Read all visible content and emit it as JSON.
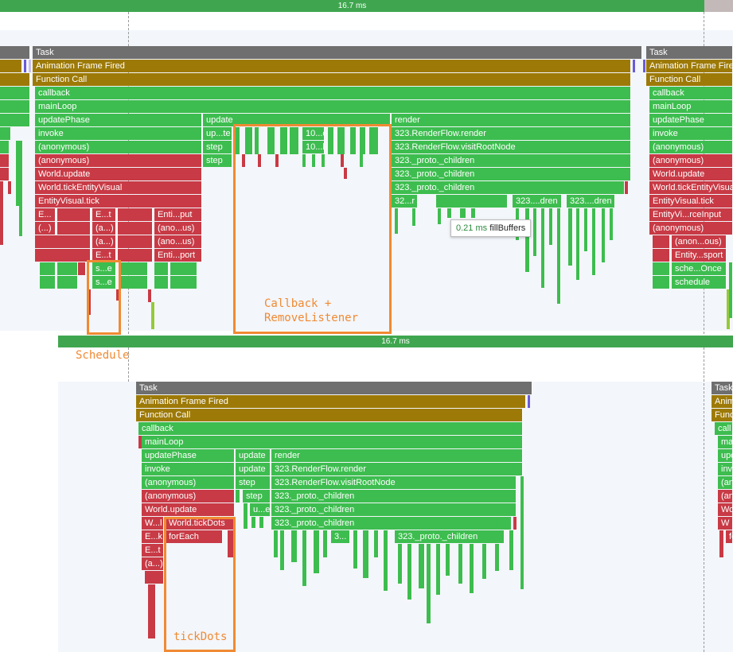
{
  "top_panel": {
    "frame_duration": "16.7 ms",
    "main": [
      {
        "row": 0,
        "label": "Task"
      },
      {
        "row": 1,
        "label": "Animation Frame Fired"
      },
      {
        "row": 2,
        "label": "Function Call"
      },
      {
        "row": 3,
        "label": "callback"
      },
      {
        "row": 4,
        "label": "mainLoop"
      },
      {
        "row": 5,
        "label": "updatePhase"
      },
      {
        "row": 6,
        "label": "invoke"
      },
      {
        "row": 7,
        "label": "(anonymous)"
      },
      {
        "row": 8,
        "label": "(anonymous)"
      },
      {
        "row": 9,
        "label": "World.update"
      },
      {
        "row": 10,
        "label": "World.tickEntityVisual"
      },
      {
        "row": 11,
        "label": "EntityVisual.tick"
      }
    ],
    "mid": [
      {
        "label": "update"
      },
      {
        "label": "up...te"
      },
      {
        "label": "step"
      },
      {
        "label": "step"
      }
    ],
    "render": [
      {
        "label": "render"
      },
      {
        "label": "323.RenderFlow.render"
      },
      {
        "label": "323.RenderFlow.visitRootNode"
      },
      {
        "label": "323._proto._children"
      },
      {
        "label": "323._proto._children"
      },
      {
        "label": "323._proto._children"
      },
      {
        "label": "32...r"
      },
      {
        "label": "323....dren"
      },
      {
        "label": "323....dren"
      }
    ],
    "small": [
      {
        "label": "10...e"
      },
      {
        "label": "10...l"
      },
      {
        "label": "E..."
      },
      {
        "label": "(...)"
      },
      {
        "label": "E...t"
      },
      {
        "label": "(a...)"
      },
      {
        "label": "(a...)"
      },
      {
        "label": "E...t"
      },
      {
        "label": "s...e"
      },
      {
        "label": "s...e"
      },
      {
        "label": "Enti...put"
      },
      {
        "label": "(ano...us)"
      },
      {
        "label": "(ano...us)"
      },
      {
        "label": "Enti...port"
      }
    ],
    "right_column": [
      {
        "label": "Task"
      },
      {
        "label": "Animation Frame Fired"
      },
      {
        "label": "Function Call"
      },
      {
        "label": "callback"
      },
      {
        "label": "mainLoop"
      },
      {
        "label": "updatePhase"
      },
      {
        "label": "invoke"
      },
      {
        "label": "(anonymous)"
      },
      {
        "label": "(anonymous)"
      },
      {
        "label": "World.update"
      },
      {
        "label": "World.tickEntityVisual"
      },
      {
        "label": "EntityVisual.tick"
      },
      {
        "label": "EntityVi...rceInput"
      },
      {
        "label": "(anonymous)"
      },
      {
        "label": "(anon...ous)"
      },
      {
        "label": "Entity...sport"
      },
      {
        "label": "sche...Once"
      },
      {
        "label": "schedule"
      }
    ],
    "tooltip": {
      "duration": "0.21 ms",
      "name": "fillBuffers"
    },
    "annotations": [
      {
        "label": "Callback +\nRemoveListener"
      },
      {
        "label": "Schedule"
      }
    ]
  },
  "bottom_panel": {
    "frame_duration": "16.7 ms",
    "main": [
      {
        "label": "Task"
      },
      {
        "label": "Animation Frame Fired"
      },
      {
        "label": "Function Call"
      },
      {
        "label": "callback"
      },
      {
        "label": "mainLoop"
      },
      {
        "label": "updatePhase"
      },
      {
        "label": "invoke"
      },
      {
        "label": "(anonymous)"
      },
      {
        "label": "(anonymous)"
      },
      {
        "label": "World.update"
      },
      {
        "label": "W...l"
      },
      {
        "label": "E...k"
      },
      {
        "label": "E...t"
      },
      {
        "label": "(a...)"
      }
    ],
    "mid": [
      {
        "label": "update"
      },
      {
        "label": "update"
      },
      {
        "label": "step"
      },
      {
        "label": "step"
      },
      {
        "label": "u...e"
      }
    ],
    "render": [
      {
        "label": "render"
      },
      {
        "label": "323.RenderFlow.render"
      },
      {
        "label": "323.RenderFlow.visitRootNode"
      },
      {
        "label": "323._proto._children"
      },
      {
        "label": "323._proto._children"
      },
      {
        "label": "323._proto._children"
      },
      {
        "label": "3..."
      },
      {
        "label": "323._proto._children"
      }
    ],
    "tickdots": [
      {
        "label": "World.tickDots"
      },
      {
        "label": "forEach"
      }
    ],
    "right_column": [
      {
        "label": "Task"
      },
      {
        "label": "Anim"
      },
      {
        "label": "Funct"
      },
      {
        "label": "call"
      },
      {
        "label": "ma"
      },
      {
        "label": "upd"
      },
      {
        "label": "inv"
      },
      {
        "label": "(an"
      },
      {
        "label": "(an"
      },
      {
        "label": "Wor"
      },
      {
        "label": "W"
      },
      {
        "label": "for"
      }
    ],
    "annotations": [
      {
        "label": "tickDots"
      }
    ]
  },
  "colors": {
    "script": "#3dbd4f",
    "js_red": "#c83a45",
    "function_call": "#9d7a07",
    "task": "#6f6f6f",
    "highlight": "#f08a33"
  }
}
